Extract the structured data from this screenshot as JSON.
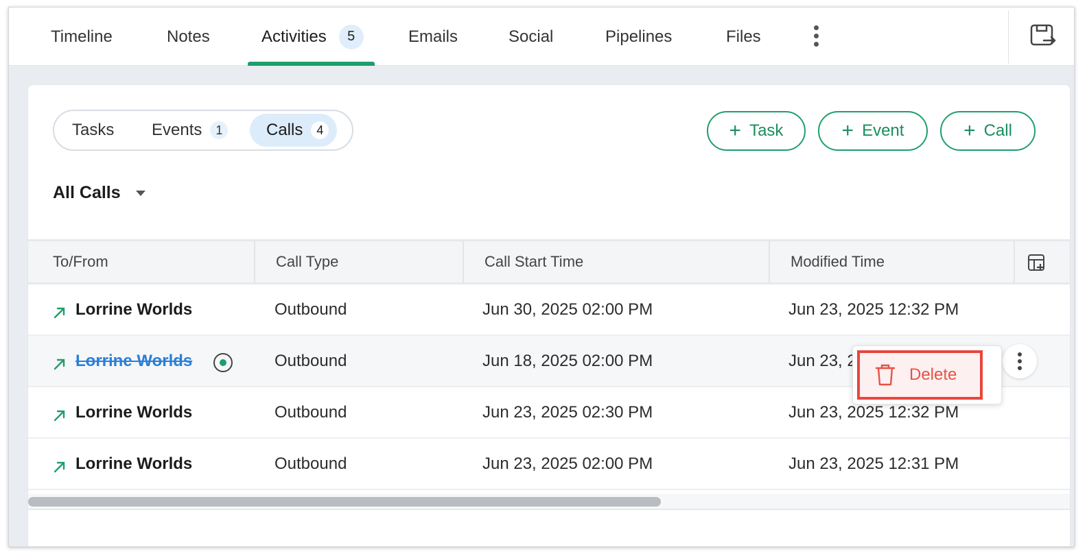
{
  "tabs": [
    {
      "label": "Timeline"
    },
    {
      "label": "Notes"
    },
    {
      "label": "Activities",
      "count": "5"
    },
    {
      "label": "Emails"
    },
    {
      "label": "Social"
    },
    {
      "label": "Pipelines"
    },
    {
      "label": "Files"
    }
  ],
  "active_tab": "Activities",
  "segment": [
    {
      "label": "Tasks"
    },
    {
      "label": "Events",
      "count": "1"
    },
    {
      "label": "Calls",
      "count": "4"
    }
  ],
  "active_segment": "Calls",
  "buttons": {
    "task": "Task",
    "event": "Event",
    "call": "Call"
  },
  "filter": {
    "label": "All Calls"
  },
  "table": {
    "headers": [
      "To/From",
      "Call Type",
      "Call Start Time",
      "Modified Time"
    ],
    "rows": [
      {
        "name": "Lorrine Worlds",
        "type": "Outbound",
        "start": "Jun 30, 2025 02:00 PM",
        "modified": "Jun 23, 2025 12:32 PM",
        "completed": false
      },
      {
        "name": "Lorrine Worlds",
        "type": "Outbound",
        "start": "Jun 18, 2025 02:00 PM",
        "modified": "Jun 23, 2",
        "completed": true
      },
      {
        "name": "Lorrine Worlds",
        "type": "Outbound",
        "start": "Jun 23, 2025 02:30 PM",
        "modified": "Jun 23, 2025 12:32 PM",
        "completed": false
      },
      {
        "name": "Lorrine Worlds",
        "type": "Outbound",
        "start": "Jun 23, 2025 02:00 PM",
        "modified": "Jun 23, 2025 12:31 PM",
        "completed": false
      }
    ]
  },
  "row_menu": {
    "delete_label": "Delete"
  },
  "colors": {
    "accent": "#1e9e6a",
    "link": "#2b7fd6",
    "danger": "#e8463c"
  }
}
